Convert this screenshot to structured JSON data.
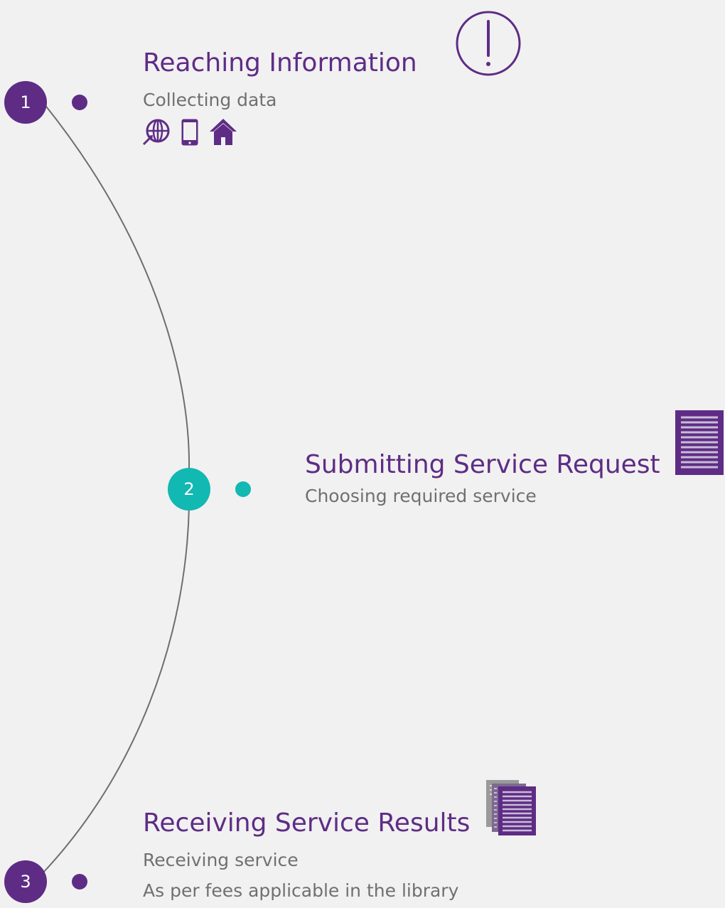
{
  "colors": {
    "purple": "#5e2c85",
    "teal": "#12b8b2",
    "gray_text": "#707070",
    "arc": "#6e6e6e",
    "background": "#f1f1f1"
  },
  "steps": [
    {
      "number": "1",
      "title": "Reaching Information",
      "lines": [
        "Collecting data"
      ],
      "icons": [
        "exclamation-circle-icon",
        "globe-icon",
        "mobile-phone-icon",
        "home-icon"
      ],
      "color": "#5e2c85"
    },
    {
      "number": "2",
      "title": "Submitting Service Request",
      "lines": [
        "Choosing required service"
      ],
      "icons": [
        "document-lines-icon"
      ],
      "color": "#12b8b2"
    },
    {
      "number": "3",
      "title": "Receiving Service Results",
      "lines": [
        "Receiving service",
        "As per fees applicable in the library"
      ],
      "icons": [
        "stacked-documents-icon"
      ],
      "color": "#5e2c85"
    }
  ]
}
